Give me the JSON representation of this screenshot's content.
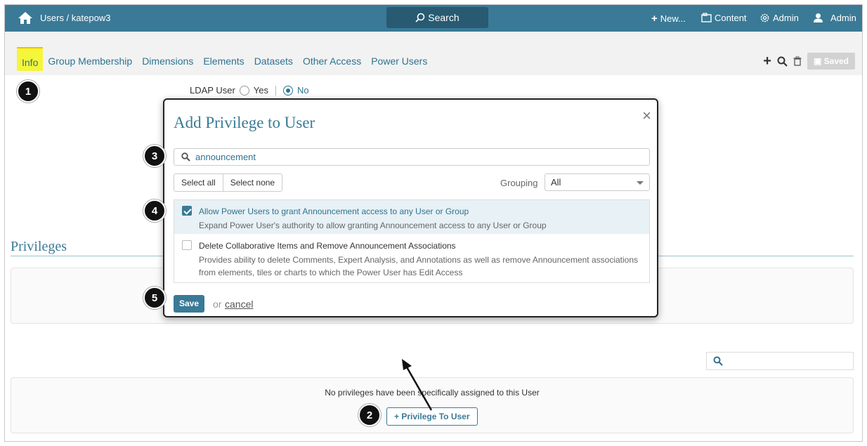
{
  "topbar": {
    "breadcrumb": "Users / katepow3",
    "search_label": "Search",
    "new_label": "New...",
    "content_label": "Content",
    "admin_menu_label": "Admin",
    "user_label": "Admin"
  },
  "tabs": [
    {
      "label": "Info"
    },
    {
      "label": "Group Membership"
    },
    {
      "label": "Dimensions"
    },
    {
      "label": "Elements"
    },
    {
      "label": "Datasets"
    },
    {
      "label": "Other Access"
    },
    {
      "label": "Power Users"
    }
  ],
  "toolbar": {
    "saved_label": "Saved"
  },
  "ldap": {
    "label": "LDAP User",
    "yes": "Yes",
    "no": "No"
  },
  "privileges": {
    "title": "Privileges",
    "empty_text": "No privileges have been specifically assigned to this User",
    "add_button": "Privilege To User"
  },
  "modal": {
    "title": "Add Privilege to User",
    "close_glyph": "×",
    "search_value": "announcement",
    "select_all": "Select all",
    "select_none": "Select none",
    "grouping_label": "Grouping",
    "grouping_value": "All",
    "items": [
      {
        "title": "Allow Power Users to grant Announcement access to any User or Group",
        "description": "Expand Power User's authority to allow granting Announcement access to any User or Group",
        "checked": true
      },
      {
        "title": "Delete Collaborative Items and Remove Announcement Associations",
        "description": "Provides ability to delete Comments, Expert Analysis, and Annotations as well as remove Announcement associations from elements, tiles or charts to which the Power User has Edit Access",
        "checked": false
      }
    ],
    "save_label": "Save",
    "or_text": "or",
    "cancel_label": "cancel"
  },
  "badges": [
    "1",
    "2",
    "3",
    "4",
    "5"
  ],
  "colors": {
    "header": "#3a7a96",
    "accent": "#2d7391",
    "highlight": "#f5f53a"
  }
}
